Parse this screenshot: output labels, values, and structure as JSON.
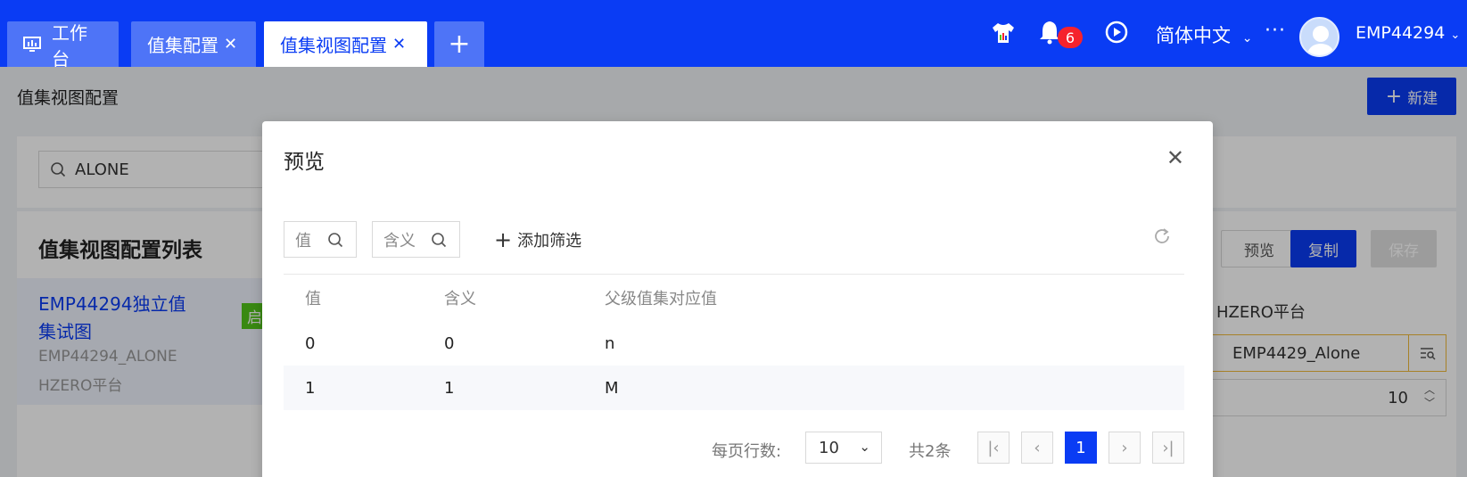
{
  "header": {
    "tabs": [
      {
        "label": "工作台",
        "closable": false,
        "active": false
      },
      {
        "label": "值集配置",
        "closable": true,
        "active": false
      },
      {
        "label": "值集视图配置",
        "closable": true,
        "active": true
      }
    ],
    "close_glyph": "✕",
    "add_tab_glyph": "+",
    "notification_count": "6",
    "language": "简体中文",
    "more_glyph": "···",
    "username": "EMP44294",
    "colors": {
      "primary": "#0a3cf4",
      "tab_inactive": "#4e74f7",
      "badge": "#f5222d"
    }
  },
  "page": {
    "title": "值集视图配置",
    "new_button": "新建",
    "search_value": "ALONE",
    "list_title": "值集视图配置列表",
    "list_item": {
      "title": "EMP44294独立值集试图",
      "code": "EMP44294_ALONE",
      "platform": "HZERO平台",
      "status_tag": "启"
    },
    "actions": {
      "preview": "预览",
      "copy": "复制",
      "save": "保存"
    },
    "form": {
      "platform_label": "HZERO平台",
      "value_set": "EMP4429_Alone",
      "number": "10"
    }
  },
  "modal": {
    "title": "预览",
    "close_glyph": "✕",
    "filters": [
      {
        "placeholder": "值"
      },
      {
        "placeholder": "含义"
      }
    ],
    "add_filter": "添加筛选",
    "table": {
      "headers": [
        "值",
        "含义",
        "父级值集对应值"
      ],
      "rows": [
        [
          "0",
          "0",
          "n"
        ],
        [
          "1",
          "1",
          "M"
        ]
      ]
    },
    "pagination": {
      "rows_per_page_label": "每页行数:",
      "page_size": "10",
      "total": "共2条",
      "current_page": "1"
    }
  }
}
